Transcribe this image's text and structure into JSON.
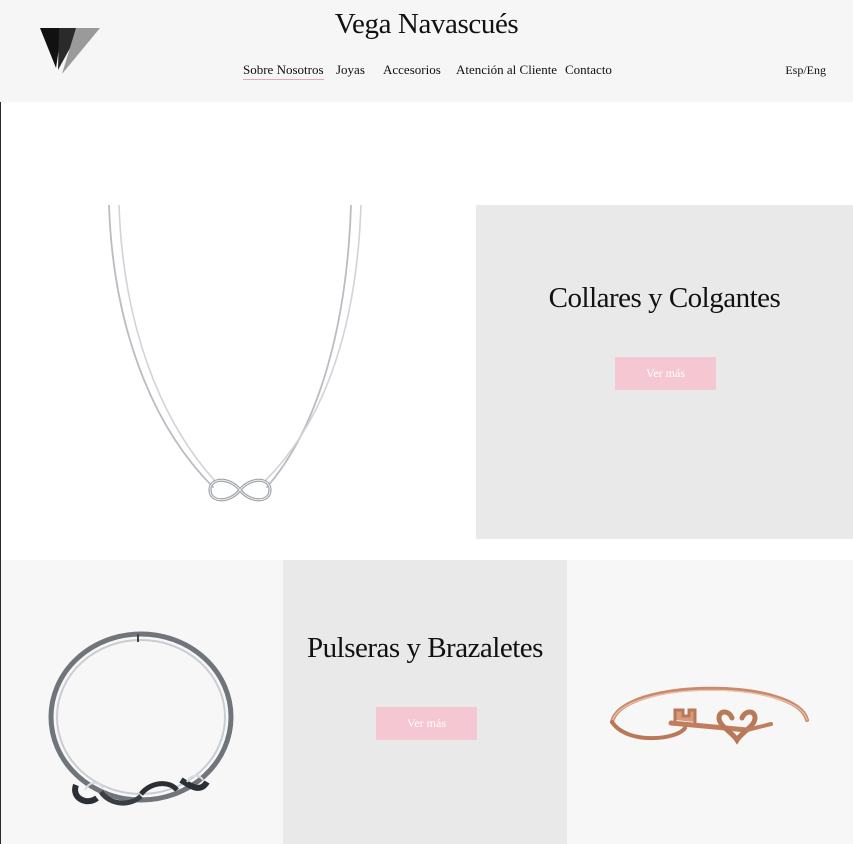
{
  "brand": {
    "name": "Vega Navascués",
    "logo_icon": "vn-monogram-icon"
  },
  "nav": {
    "items": [
      {
        "label": "Sobre Nosotros",
        "active": true
      },
      {
        "label": "Joyas",
        "active": false
      },
      {
        "label": "Accesorios",
        "active": false
      },
      {
        "label": "Atención al Cliente",
        "active": false
      },
      {
        "label": "Contacto",
        "active": false
      }
    ],
    "language_switch": "Esp/Eng"
  },
  "sections": {
    "necklaces": {
      "title": "Collares y Colgantes",
      "cta_label": "Ver más",
      "image": "infinity-necklace-image"
    },
    "bracelets": {
      "title": "Pulseras y Brazaletes",
      "cta_label": "Ver más",
      "image_left": "silver-knot-bangle-image",
      "image_right": "rose-gold-key-bangle-image"
    }
  },
  "colors": {
    "accent": "#f4c7d2",
    "header_bg": "#f6f6f6",
    "panel_gray": "#e9e9e9",
    "text": "#111111"
  }
}
